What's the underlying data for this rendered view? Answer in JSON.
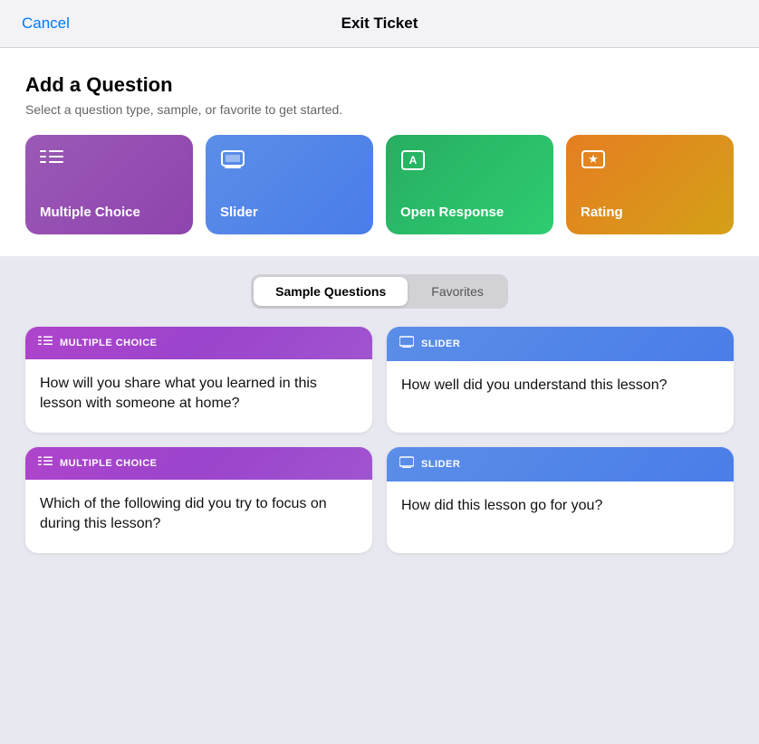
{
  "header": {
    "cancel_label": "Cancel",
    "title": "Exit Ticket"
  },
  "add_question": {
    "title": "Add a Question",
    "subtitle": "Select a question type, sample, or favorite to get started."
  },
  "type_cards": [
    {
      "id": "multiple-choice",
      "label": "Multiple Choice",
      "icon": "≡",
      "color_class": "card-multiple-choice"
    },
    {
      "id": "slider",
      "label": "Slider",
      "icon": "🖥",
      "color_class": "card-slider"
    },
    {
      "id": "open-response",
      "label": "Open Response",
      "icon": "A",
      "color_class": "card-open-response"
    },
    {
      "id": "rating",
      "label": "Rating",
      "icon": "★",
      "color_class": "card-rating"
    }
  ],
  "tabs": [
    {
      "id": "sample-questions",
      "label": "Sample Questions",
      "active": true
    },
    {
      "id": "favorites",
      "label": "Favorites",
      "active": false
    }
  ],
  "sample_cards": [
    {
      "id": "mc-1",
      "type": "MULTIPLE CHOICE",
      "type_id": "multiple-choice",
      "question": "How will you share what you learned in this lesson with someone at home?"
    },
    {
      "id": "slider-1",
      "type": "SLIDER",
      "type_id": "slider",
      "question": "How well did you understand this lesson?"
    },
    {
      "id": "mc-2",
      "type": "MULTIPLE CHOICE",
      "type_id": "multiple-choice",
      "question": "Which of the following did you try to focus on during this lesson?"
    },
    {
      "id": "slider-2",
      "type": "SLIDER",
      "type_id": "slider",
      "question": "How did this lesson go for you?"
    }
  ]
}
